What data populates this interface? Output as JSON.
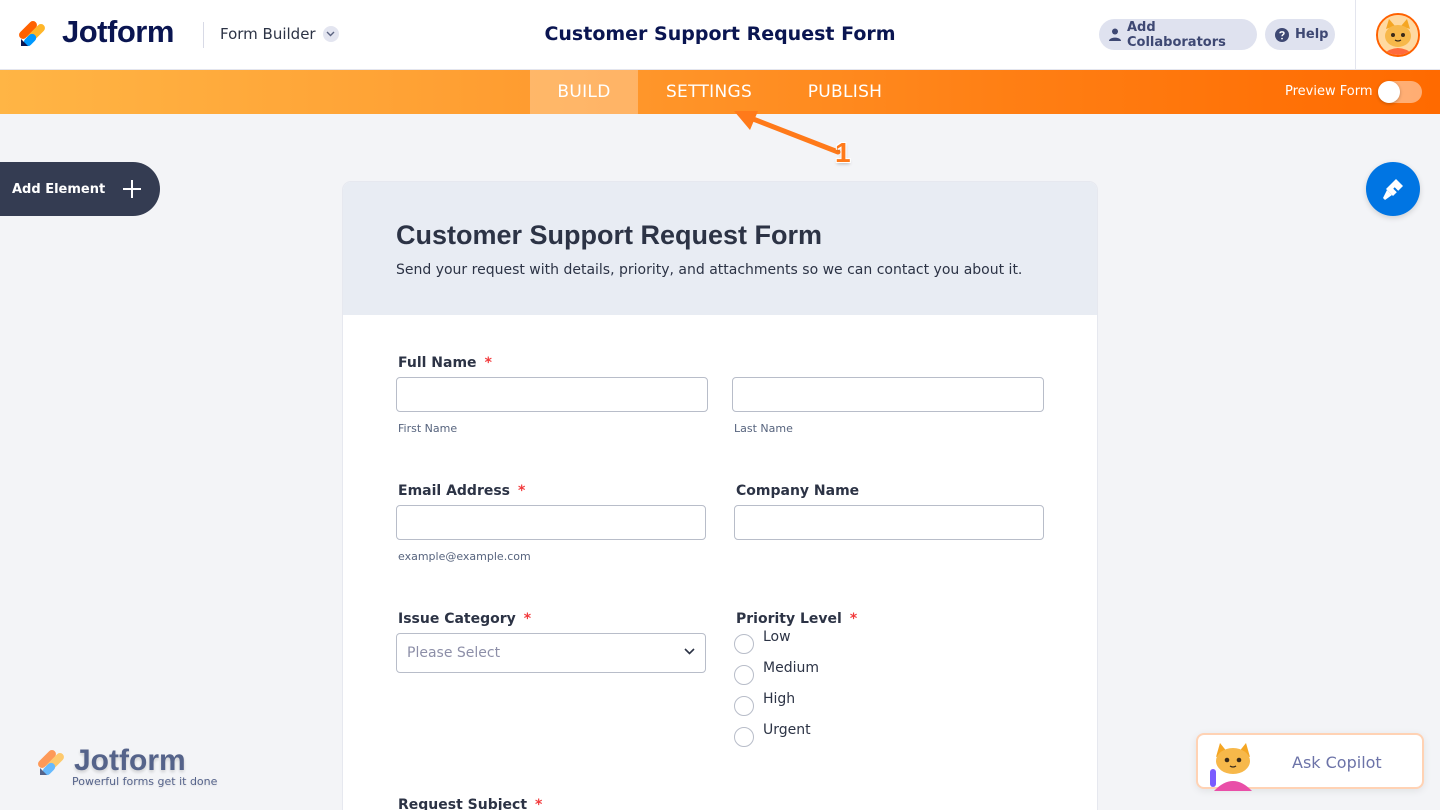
{
  "header": {
    "brand": "Jotform",
    "mode_label": "Form Builder",
    "title": "Customer Support Request Form",
    "add_collaborators": "Add Collaborators",
    "help": "Help"
  },
  "nav": {
    "tabs": [
      "BUILD",
      "SETTINGS",
      "PUBLISH"
    ],
    "active_tab": "BUILD",
    "preview_label": "Preview Form",
    "preview_on": false
  },
  "annotation": {
    "number": "1"
  },
  "sidebar": {
    "add_element": "Add Element"
  },
  "form": {
    "title": "Customer Support Request Form",
    "subtitle": "Send your request with details, priority, and attachments so we can contact you about it.",
    "full_name": {
      "label": "Full Name",
      "required": "*",
      "first_sub": "First Name",
      "last_sub": "Last Name"
    },
    "email": {
      "label": "Email Address",
      "required": "*",
      "sub": "example@example.com"
    },
    "company": {
      "label": "Company Name"
    },
    "issue_category": {
      "label": "Issue Category",
      "required": "*",
      "placeholder": "Please Select"
    },
    "priority": {
      "label": "Priority Level",
      "required": "*",
      "options": [
        "Low",
        "Medium",
        "High",
        "Urgent"
      ]
    },
    "request_subject": {
      "label": "Request Subject",
      "required": "*"
    }
  },
  "watermark": {
    "brand": "Jotform",
    "tagline": "Powerful forms get it done"
  },
  "copilot": {
    "label": "Ask Copilot"
  },
  "colors": {
    "brand_orange": "#ff6100",
    "navy": "#0a1551",
    "blue": "#0075e3"
  }
}
